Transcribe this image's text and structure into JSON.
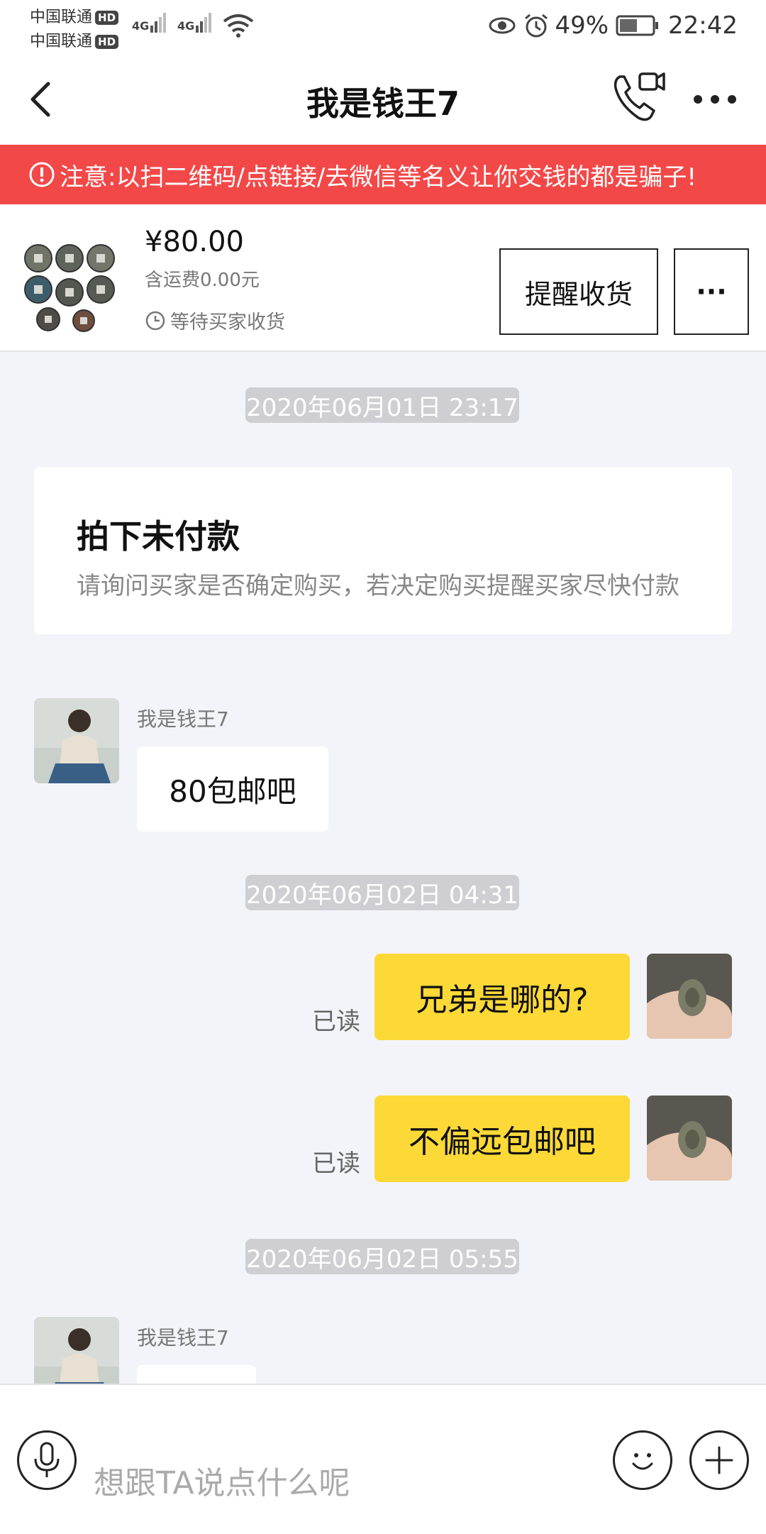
{
  "status_bar": {
    "carrier1": "中国联通",
    "carrier2": "中国联通",
    "hd_badge": "HD",
    "network": "4G",
    "battery": "49%",
    "time": "22:42"
  },
  "nav": {
    "title": "我是钱王7"
  },
  "warning": {
    "text": "注意:以扫二维码/点链接/去微信等名义让你交钱的都是骗子!"
  },
  "product": {
    "price": "¥80.00",
    "shipping": "含运费0.00元",
    "status": "等待买家收货",
    "remind_button": "提醒收货",
    "more_button": "···"
  },
  "chat": {
    "timestamps": [
      "2020年06月01日 23:17",
      "2020年06月02日 04:31",
      "2020年06月02日 05:55"
    ],
    "order_card": {
      "title": "拍下未付款",
      "desc": "请询问买家是否确定购买，若决定购买提醒买家尽快付款"
    },
    "messages": [
      {
        "sender": "我是钱王7",
        "text": "80包邮吧",
        "side": "left"
      },
      {
        "text": "兄弟是哪的?",
        "side": "right",
        "status": "已读"
      },
      {
        "text": "不偏远包邮吧",
        "side": "right",
        "status": "已读"
      },
      {
        "sender": "我是钱王7",
        "text": "",
        "side": "left"
      }
    ]
  },
  "input": {
    "placeholder": "想跟TA说点什么呢"
  },
  "colors": {
    "warning_bg": "#f34848",
    "my_bubble": "#fcd937",
    "background": "#f3f4f9"
  }
}
